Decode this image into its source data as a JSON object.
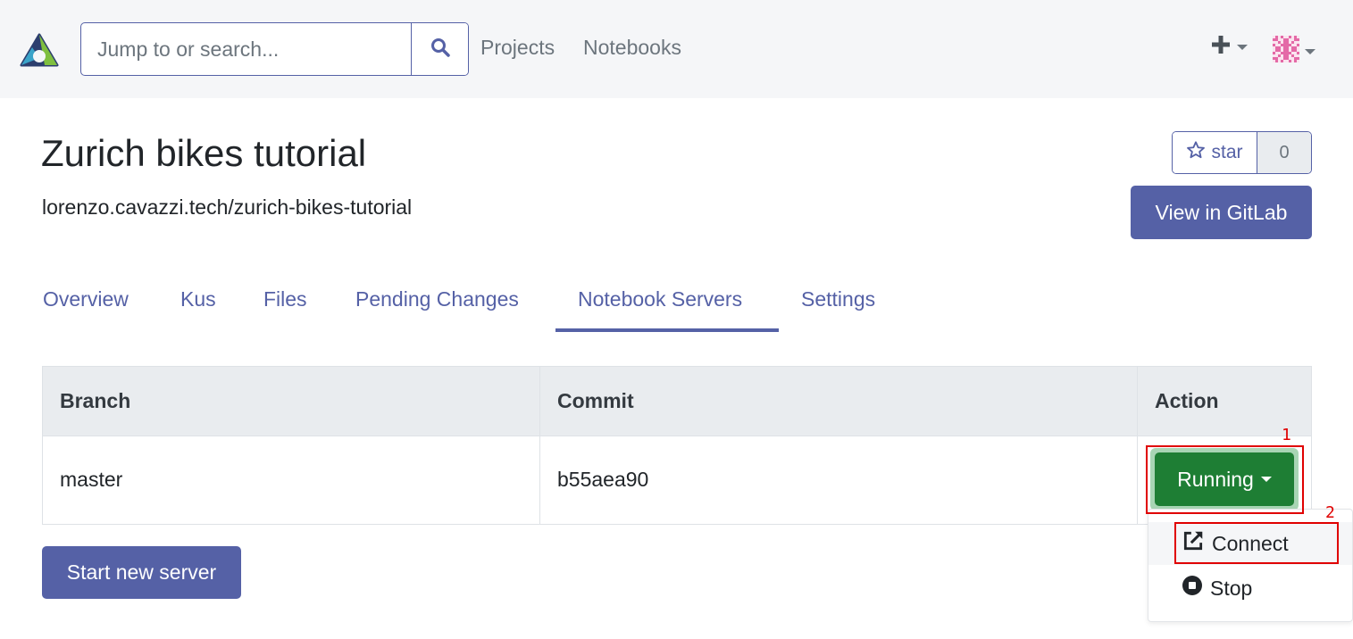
{
  "navbar": {
    "search": {
      "placeholder": "Jump to or search..."
    },
    "links": [
      "Projects",
      "Notebooks"
    ],
    "icons": {
      "logo": "renku-logo-icon",
      "search": "search-icon",
      "plus": "plus-icon",
      "avatar": "identicon-avatar"
    }
  },
  "project": {
    "title": "Zurich bikes tutorial",
    "path": "lorenzo.cavazzi.tech/zurich-bikes-tutorial",
    "star_label": "star",
    "star_count": "0",
    "gitlab_label": "View in GitLab"
  },
  "tabs": [
    "Overview",
    "Kus",
    "Files",
    "Pending Changes",
    "Notebook Servers",
    "Settings"
  ],
  "active_tab": "Notebook Servers",
  "table": {
    "headers": [
      "Branch",
      "Commit",
      "Action"
    ],
    "rows": [
      {
        "branch": "master",
        "commit": "b55aea90",
        "action": "Running"
      }
    ]
  },
  "start_button": "Start new server",
  "dropdown": {
    "items": [
      {
        "label": "Connect",
        "icon": "external-link-icon"
      },
      {
        "label": "Stop",
        "icon": "stop-icon"
      }
    ]
  },
  "annotations": [
    "1",
    "2"
  ],
  "colors": {
    "primary": "#5561a6",
    "success": "#1e7e34",
    "header_bg": "#e9ecef",
    "annotation": "#e00000"
  }
}
